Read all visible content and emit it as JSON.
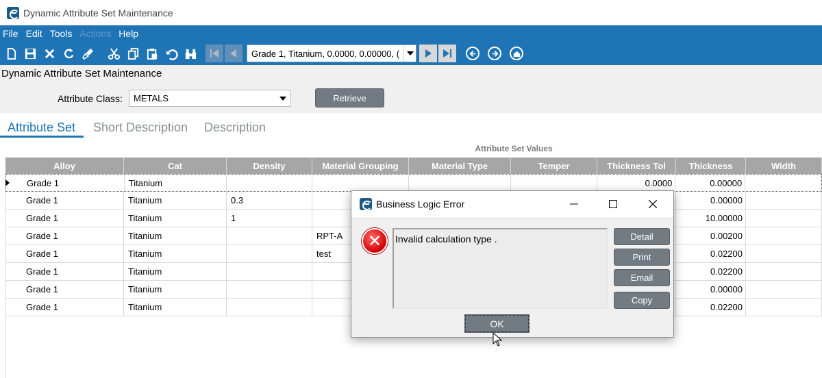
{
  "window": {
    "title": "Dynamic Attribute Set Maintenance"
  },
  "menu": {
    "items": [
      "File",
      "Edit",
      "Tools",
      "Actions",
      "Help"
    ]
  },
  "toolbar": {
    "record_value": "Grade 1, Titanium, 0.0000, 0.00000, (",
    "icons": [
      "new-icon",
      "save-icon",
      "delete-icon",
      "refresh-icon",
      "clear-icon",
      "cut-icon",
      "copy-icon",
      "paste-icon",
      "undo-icon",
      "search-icon",
      "first-record-icon",
      "prev-record-icon",
      "next-record-icon",
      "last-record-icon",
      "back-icon",
      "forward-icon",
      "home-icon"
    ]
  },
  "form": {
    "title": "Dynamic Attribute Set Maintenance",
    "attribute_class_label": "Attribute Class:",
    "attribute_class_value": "METALS",
    "retrieve_label": "Retrieve"
  },
  "tabs": [
    {
      "label": "Attribute Set",
      "active": true
    },
    {
      "label": "Short Description",
      "active": false
    },
    {
      "label": "Description",
      "active": false
    }
  ],
  "grid": {
    "group_header": "Attribute Set Values",
    "columns": [
      "Alloy",
      "Cat",
      "Density",
      "Material Grouping",
      "Material Type",
      "Temper",
      "Thickness Tol",
      "Thickness",
      "Width"
    ],
    "rows": [
      {
        "alloy": "Grade 1",
        "cat": "Titanium",
        "density": "",
        "grouping": "",
        "type": "",
        "temper": "",
        "tol": "0.0000",
        "thickness": "0.00000",
        "width": ""
      },
      {
        "alloy": "Grade 1",
        "cat": "Titanium",
        "density": "0.3",
        "grouping": "",
        "type": "",
        "temper": "",
        "tol": "",
        "thickness": "0.00000",
        "width": ""
      },
      {
        "alloy": "Grade 1",
        "cat": "Titanium",
        "density": "1",
        "grouping": "",
        "type": "",
        "temper": "",
        "tol": "",
        "thickness": "10.00000",
        "width": ""
      },
      {
        "alloy": "Grade 1",
        "cat": "Titanium",
        "density": "",
        "grouping": "RPT-A",
        "type": "",
        "temper": "",
        "tol": "",
        "thickness": "0.00200",
        "width": ""
      },
      {
        "alloy": "Grade 1",
        "cat": "Titanium",
        "density": "",
        "grouping": "test",
        "type": "",
        "temper": "",
        "tol": "",
        "thickness": "0.02200",
        "width": ""
      },
      {
        "alloy": "Grade 1",
        "cat": "Titanium",
        "density": "",
        "grouping": "",
        "type": "",
        "temper": "",
        "tol": "",
        "thickness": "0.02200",
        "width": ""
      },
      {
        "alloy": "Grade 1",
        "cat": "Titanium",
        "density": "",
        "grouping": "",
        "type": "",
        "temper": "",
        "tol": "",
        "thickness": "0.00000",
        "width": ""
      },
      {
        "alloy": "Grade 1",
        "cat": "Titanium",
        "density": "",
        "grouping": "",
        "type": "",
        "temper": "",
        "tol": "",
        "thickness": "0.02200",
        "width": ""
      }
    ]
  },
  "dialog": {
    "title": "Business Logic Error",
    "message": "Invalid calculation type .",
    "buttons": {
      "detail": "Detail",
      "print": "Print",
      "email": "Email",
      "copy": "Copy",
      "ok": "OK"
    }
  }
}
